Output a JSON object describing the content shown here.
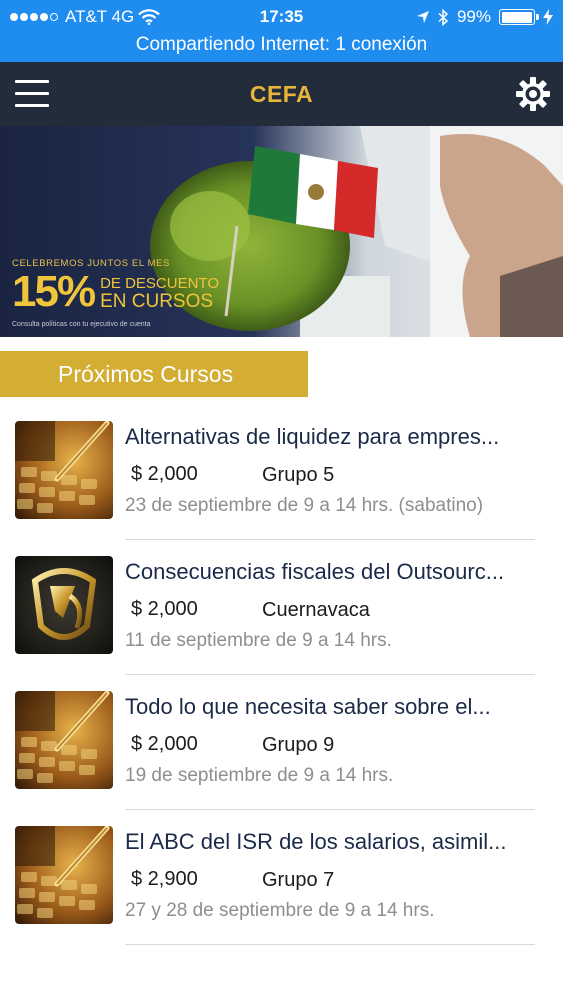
{
  "status_bar": {
    "carrier": "AT&T 4G",
    "time": "17:35",
    "battery": "99%",
    "battery_level": 0.99,
    "hotspot": "Compartiendo Internet: 1 conexión",
    "color": "#1f8cf0"
  },
  "header": {
    "title": "CEFA",
    "menu_icon": "hamburger-menu-icon",
    "settings_icon": "gear-icon",
    "background": "#232c3b",
    "title_color": "#e6b53a"
  },
  "banner": {
    "line1": "CELEBREMOS JUNTOS EL MES",
    "percent": "15%",
    "desc1": "DE DESCUENTO",
    "desc2": "EN CURSOS",
    "fine_print": "Consulta políticas con tu ejecutivo de cuenta"
  },
  "section": {
    "label": "Próximos Cursos",
    "color": "#d4ad35"
  },
  "courses": [
    {
      "title": "Alternativas de liquidez para  empres...",
      "price": "$ 2,000",
      "group": "Grupo 5",
      "date": "23 de septiembre de 9 a 14 hrs. (sabatino)",
      "thumb": "calculator-pen-thumbnail"
    },
    {
      "title": "Consecuencias fiscales del Outsourc...",
      "price": "$ 2,000",
      "group": "Cuernavaca",
      "date": "11 de septiembre de 9 a 14 hrs.",
      "thumb": "gold-emblem-thumbnail"
    },
    {
      "title": "Todo lo que necesita saber sobre el...",
      "price": "$ 2,000",
      "group": "Grupo 9",
      "date": "19 de septiembre de 9 a 14 hrs.",
      "thumb": "calculator-pen-thumbnail"
    },
    {
      "title": "El ABC del ISR de los salarios, asimil...",
      "price": "$ 2,900",
      "group": "Grupo 7",
      "date": "27 y 28 de septiembre de 9 a 14 hrs.",
      "thumb": "calculator-pen-thumbnail"
    }
  ]
}
